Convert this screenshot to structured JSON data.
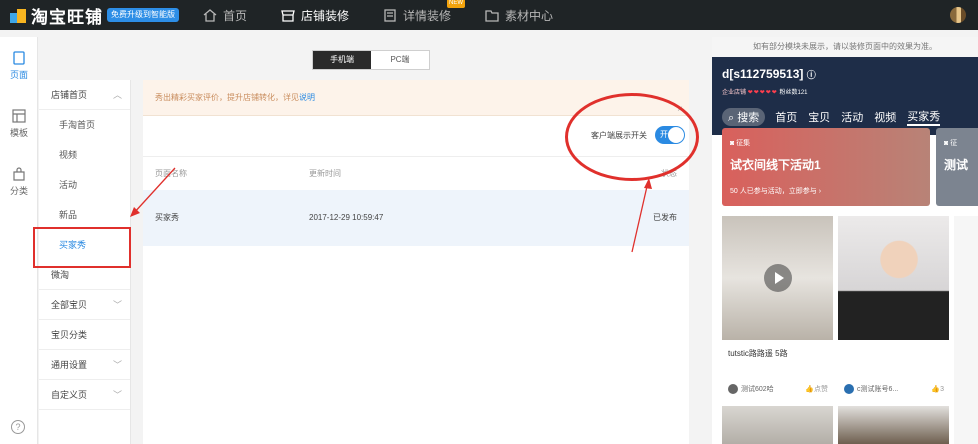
{
  "topbar": {
    "logo_text": "淘宝旺铺",
    "logo_badge": "免费升级到智能版",
    "nav": [
      {
        "label": "首页",
        "icon": "home-icon"
      },
      {
        "label": "店铺装修",
        "icon": "store-icon",
        "active": true
      },
      {
        "label": "详情装修",
        "icon": "document-icon",
        "badge": "NEW"
      },
      {
        "label": "素材中心",
        "icon": "folder-icon"
      }
    ]
  },
  "leftbar": {
    "items": [
      {
        "label": "页面",
        "icon": "page-icon",
        "active": true
      },
      {
        "label": "模板",
        "icon": "template-icon"
      },
      {
        "label": "分类",
        "icon": "bag-icon"
      }
    ],
    "help": "?"
  },
  "switcher": {
    "mobile": "手机端",
    "pc": "PC端"
  },
  "menu": {
    "shop_home": "店铺首页",
    "sub_items": [
      "手淘首页",
      "视频",
      "活动",
      "新品",
      "买家秀",
      "微淘"
    ],
    "all_items": "全部宝贝",
    "category": "宝贝分类",
    "general": "通用设置",
    "custom": "自定义页"
  },
  "notice": {
    "text": "秀出精彩买家评价，提升店铺转化，详见",
    "link": "说明"
  },
  "toggle": {
    "label": "客户端展示开关",
    "state": "开"
  },
  "table": {
    "headers": [
      "页面名称",
      "更新时间",
      "状态"
    ],
    "rows": [
      {
        "name": "买家秀",
        "time": "2017-12-29 10:59:47",
        "status": "已发布"
      }
    ]
  },
  "preview": {
    "tip": "如有部分模块未展示，请以装修页面中的效果为准。",
    "shop_name": "d[s112759513]",
    "shop_level": "企业店铺",
    "hearts": "❤❤❤❤❤",
    "fans": "粉丝数121",
    "search": "搜索",
    "tabs": [
      "首页",
      "宝贝",
      "活动",
      "视频",
      "买家秀"
    ],
    "banner": {
      "tag": "征集",
      "title": "试衣间线下活动1",
      "desc": "50 人已参与活动，立即参与"
    },
    "banner2": {
      "tag": "征",
      "title": "测试"
    },
    "cards": [
      {
        "caption": "tutstic路路遥 5路",
        "user": "测试602哈",
        "likes": "点赞"
      },
      {
        "caption": "",
        "user": "c测试账号6...",
        "likes": "3"
      }
    ]
  }
}
